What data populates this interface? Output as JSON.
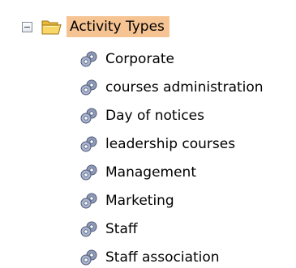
{
  "tree": {
    "root": {
      "label": "Activity Types",
      "expander_icon": "collapse-minus-icon",
      "icon": "folder-open-icon",
      "highlight_color": "#f6c493"
    },
    "items": [
      {
        "label": "Corporate",
        "icon": "gears-icon"
      },
      {
        "label": "courses administration",
        "icon": "gears-icon"
      },
      {
        "label": "Day of notices",
        "icon": "gears-icon"
      },
      {
        "label": "leadership courses",
        "icon": "gears-icon"
      },
      {
        "label": "Management",
        "icon": "gears-icon"
      },
      {
        "label": "Marketing",
        "icon": "gears-icon"
      },
      {
        "label": "Staff",
        "icon": "gears-icon"
      },
      {
        "label": "Staff association",
        "icon": "gears-icon"
      }
    ]
  }
}
